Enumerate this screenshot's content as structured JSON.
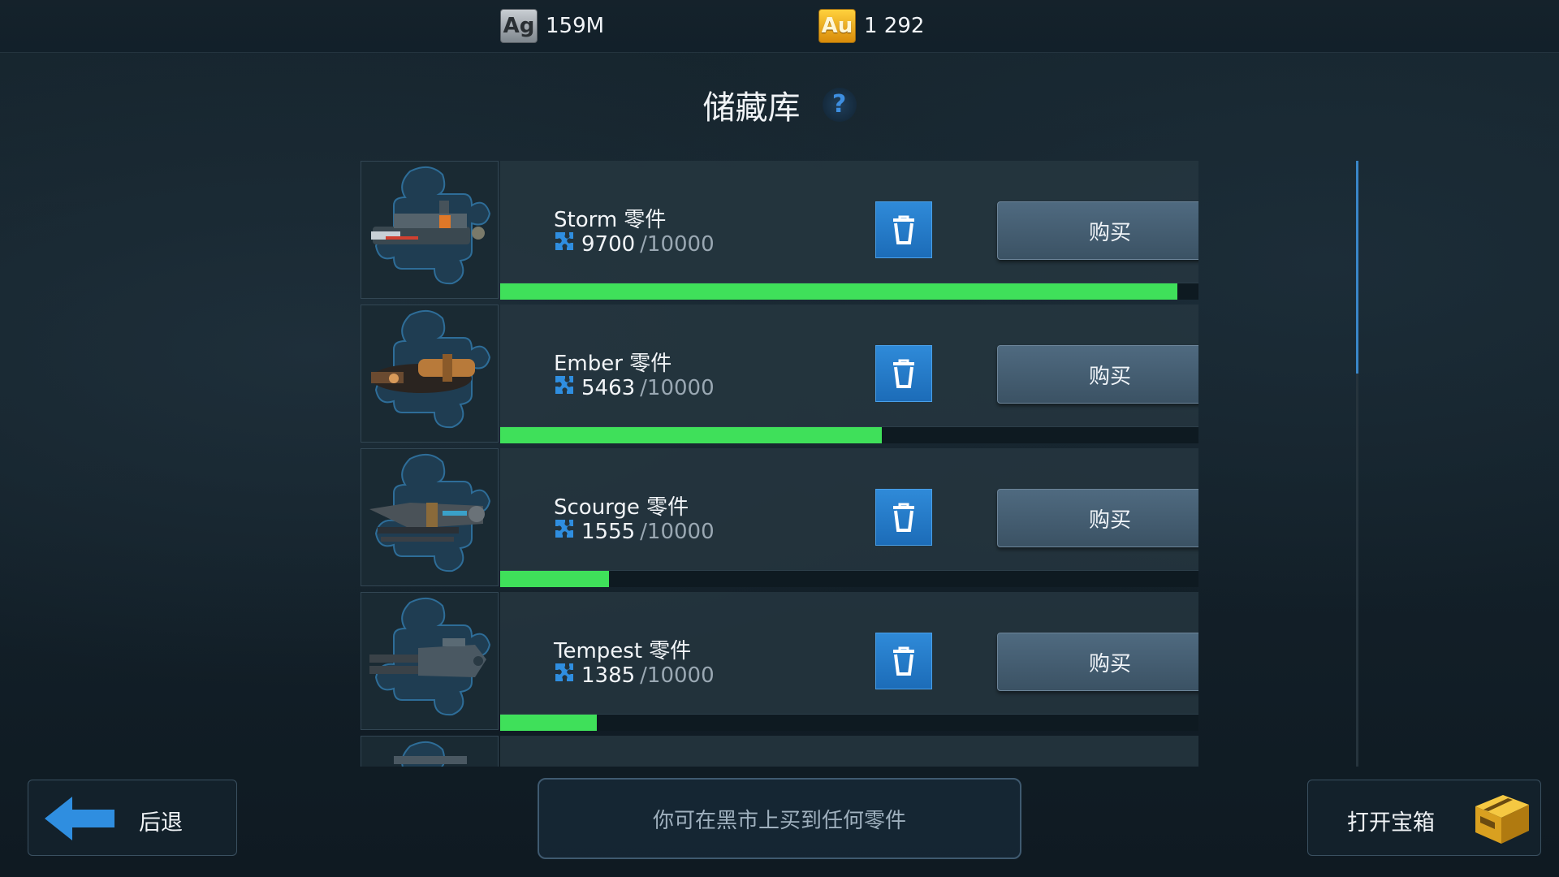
{
  "currency": {
    "silver": {
      "icon": "Ag",
      "value": "159M"
    },
    "gold": {
      "icon": "Au",
      "value": "1 292"
    }
  },
  "header": {
    "title": "储藏库",
    "help": "?"
  },
  "items": [
    {
      "name": "Storm 零件",
      "owned": "9700",
      "total": "/10000",
      "progress": 0.97,
      "buy_label": "购买",
      "icon": "storm-weapon-icon"
    },
    {
      "name": "Ember 零件",
      "owned": "5463",
      "total": "/10000",
      "progress": 0.5463,
      "buy_label": "购买",
      "icon": "ember-weapon-icon"
    },
    {
      "name": "Scourge 零件",
      "owned": "1555",
      "total": "/10000",
      "progress": 0.1555,
      "buy_label": "购买",
      "icon": "scourge-weapon-icon"
    },
    {
      "name": "Tempest 零件",
      "owned": "1385",
      "total": "/10000",
      "progress": 0.1385,
      "buy_label": "购买",
      "icon": "tempest-weapon-icon"
    }
  ],
  "footer": {
    "back_label": "后退",
    "hint": "你可在黑市上买到任何零件",
    "chest_label": "打开宝箱"
  },
  "colors": {
    "progress": "#3fe05a",
    "trash": "#2078c8",
    "accent": "#3a86c8"
  }
}
